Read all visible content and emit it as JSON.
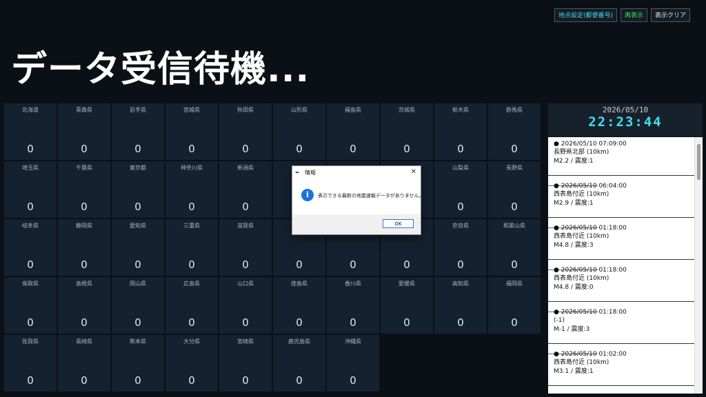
{
  "buttons": {
    "location": "地点設定(郵便番号)",
    "redisplay": "再表示",
    "clear": "表示クリア"
  },
  "title": "データ受信待機...",
  "prefectures": [
    {
      "name": "北海道",
      "value": "0"
    },
    {
      "name": "青森県",
      "value": "0"
    },
    {
      "name": "岩手県",
      "value": "0"
    },
    {
      "name": "宮城県",
      "value": "0"
    },
    {
      "name": "秋田県",
      "value": "0"
    },
    {
      "name": "山形県",
      "value": "0"
    },
    {
      "name": "福島県",
      "value": "0"
    },
    {
      "name": "茨城県",
      "value": "0"
    },
    {
      "name": "栃木県",
      "value": "0"
    },
    {
      "name": "群馬県",
      "value": "0"
    },
    {
      "name": "埼玉県",
      "value": "0"
    },
    {
      "name": "千葉県",
      "value": "0"
    },
    {
      "name": "東京都",
      "value": "0"
    },
    {
      "name": "神奈川県",
      "value": "0"
    },
    {
      "name": "新潟県",
      "value": "0"
    },
    {
      "name": "",
      "value": "0"
    },
    {
      "name": "",
      "value": "0"
    },
    {
      "name": "",
      "value": "0"
    },
    {
      "name": "山梨県",
      "value": "0"
    },
    {
      "name": "長野県",
      "value": "0"
    },
    {
      "name": "岐阜県",
      "value": "0"
    },
    {
      "name": "静岡県",
      "value": "0"
    },
    {
      "name": "愛知県",
      "value": "0"
    },
    {
      "name": "三重県",
      "value": "0"
    },
    {
      "name": "滋賀県",
      "value": "0"
    },
    {
      "name": "",
      "value": "0"
    },
    {
      "name": "",
      "value": "0"
    },
    {
      "name": "",
      "value": "0"
    },
    {
      "name": "奈良県",
      "value": "0"
    },
    {
      "name": "和歌山県",
      "value": "0"
    },
    {
      "name": "鳥取県",
      "value": "0"
    },
    {
      "name": "島根県",
      "value": "0"
    },
    {
      "name": "岡山県",
      "value": "0"
    },
    {
      "name": "広島県",
      "value": "0"
    },
    {
      "name": "山口県",
      "value": "0"
    },
    {
      "name": "徳島県",
      "value": "0"
    },
    {
      "name": "香川県",
      "value": "0"
    },
    {
      "name": "愛媛県",
      "value": "0"
    },
    {
      "name": "高知県",
      "value": "0"
    },
    {
      "name": "福岡県",
      "value": "0"
    },
    {
      "name": "佐賀県",
      "value": "0"
    },
    {
      "name": "長崎県",
      "value": "0"
    },
    {
      "name": "熊本県",
      "value": "0"
    },
    {
      "name": "大分県",
      "value": "0"
    },
    {
      "name": "宮崎県",
      "value": "0"
    },
    {
      "name": "鹿児島県",
      "value": "0"
    },
    {
      "name": "沖縄県",
      "value": "0"
    }
  ],
  "clock": {
    "date": "2026/05/10",
    "time": "22:23:44"
  },
  "feed": [
    {
      "datetime": "● 2026/05/10 07:09:00",
      "location": "長野県北部 (10km)",
      "detail": "M2.2 / 震度:1"
    },
    {
      "datetime": "● 2026/05/10 06:04:00",
      "location": "西表島付近 (10km)",
      "detail": "M2.9 / 震度:1"
    },
    {
      "datetime": "● 2026/05/10 01:18:00",
      "location": "西表島付近 (10km)",
      "detail": "M4.8 / 震度:3"
    },
    {
      "datetime": "● 2026/05/10 01:18:00",
      "location": "西表島付近 (10km)",
      "detail": "M4.8 / 震度:0"
    },
    {
      "datetime": "● 2026/05/10 01:18:00",
      "location": " (-1)",
      "detail": "M-1 / 震度:3"
    },
    {
      "datetime": "● 2026/05/10 01:02:00",
      "location": "西表島付近 (10km)",
      "detail": "M3.1 / 震度:1"
    }
  ],
  "dialog": {
    "title": "情報",
    "message": "表示できる最新の地震速報データがありません。",
    "ok": "OK",
    "close": "✕",
    "info_glyph": "i",
    "app_glyph": "✒"
  }
}
